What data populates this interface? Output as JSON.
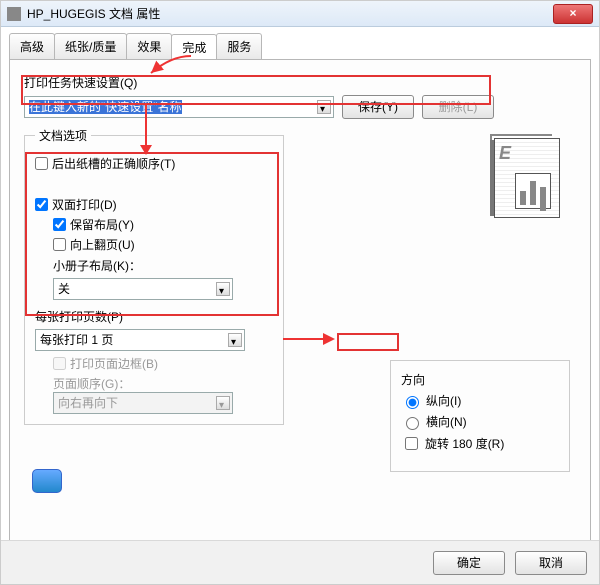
{
  "window": {
    "title": "HP_HUGEGIS 文档 属性",
    "close_label": "×"
  },
  "tabs": [
    "高级",
    "纸张/质量",
    "效果",
    "完成",
    "服务"
  ],
  "active_tab_index": 3,
  "quickset": {
    "label": "打印任务快速设置(Q)",
    "combo_value": "在此键入新的\"快速设置\"名称",
    "save_label": "保存(Y)",
    "delete_label": "删除(L)"
  },
  "doc_options": {
    "legend": "文档选项",
    "rear_tray": {
      "label": "后出纸槽的正确顺序(T)",
      "checked": false
    },
    "duplex": {
      "label": "双面打印(D)",
      "checked": true
    },
    "keep_layout": {
      "label": "保留布局(Y)",
      "checked": true
    },
    "flip_up": {
      "label": "向上翻页(U)",
      "checked": false
    },
    "booklet_label": "小册子布局(K)：",
    "booklet_value": "关",
    "pages_per_sheet_label": "每张打印页数(P)",
    "pages_per_sheet_value": "每张打印 1 页",
    "print_border": {
      "label": "打印页面边框(B)",
      "checked": false
    },
    "page_order_label": "页面顺序(G)：",
    "page_order_value": "向右再向下"
  },
  "orientation": {
    "legend": "方向",
    "portrait": {
      "label": "纵向(I)",
      "checked": true
    },
    "landscape": {
      "label": "横向(N)",
      "checked": false
    },
    "rotate": {
      "label": "旋转 180 度(R)",
      "checked": false
    }
  },
  "footer": {
    "ok": "确定",
    "cancel": "取消"
  }
}
